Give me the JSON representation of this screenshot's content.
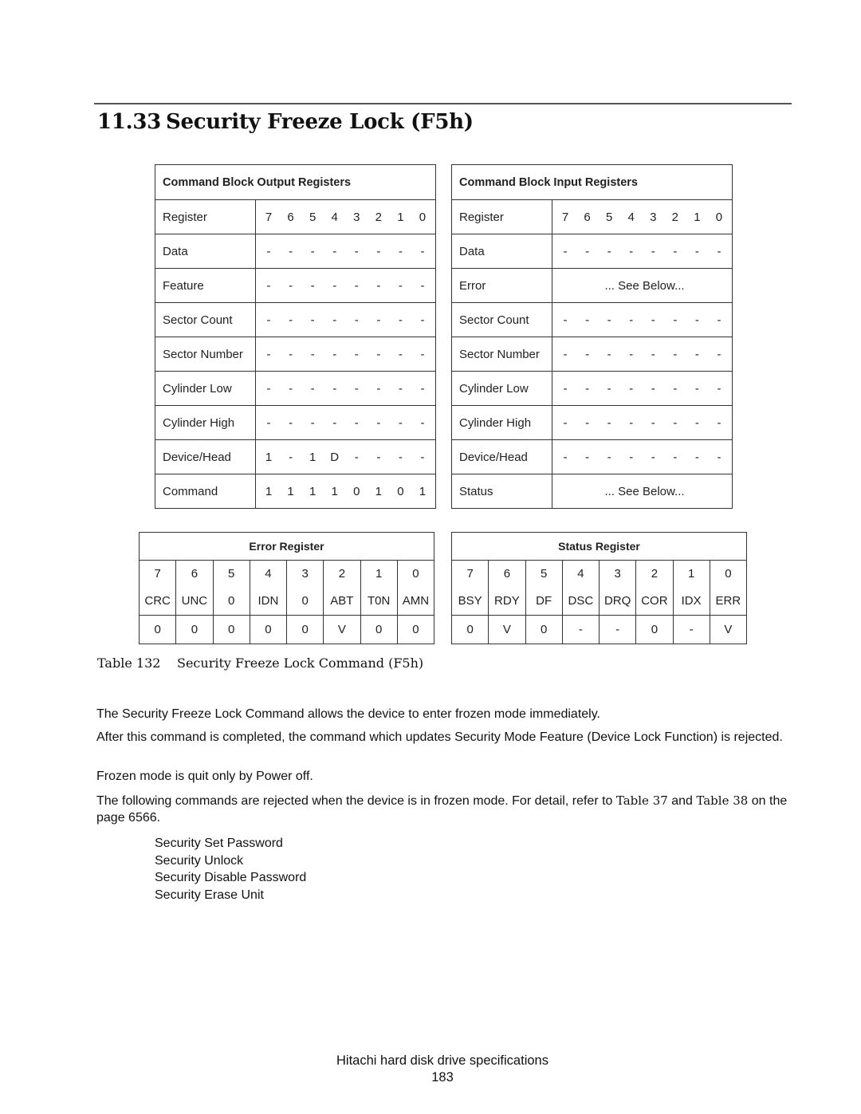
{
  "section": {
    "number": "11.33",
    "title": "Security Freeze Lock (F5h)"
  },
  "output_registers": {
    "header": "Command Block Output Registers",
    "rows": [
      {
        "name": "Register",
        "bits": [
          "7",
          "6",
          "5",
          "4",
          "3",
          "2",
          "1",
          "0"
        ]
      },
      {
        "name": "Data",
        "bits": [
          "-",
          "-",
          "-",
          "-",
          "-",
          "-",
          "-",
          "-"
        ]
      },
      {
        "name": "Feature",
        "bits": [
          "-",
          "-",
          "-",
          "-",
          "-",
          "-",
          "-",
          "-"
        ]
      },
      {
        "name": "Sector Count",
        "bits": [
          "-",
          "-",
          "-",
          "-",
          "-",
          "-",
          "-",
          "-"
        ]
      },
      {
        "name": "Sector Number",
        "bits": [
          "-",
          "-",
          "-",
          "-",
          "-",
          "-",
          "-",
          "-"
        ]
      },
      {
        "name": "Cylinder Low",
        "bits": [
          "-",
          "-",
          "-",
          "-",
          "-",
          "-",
          "-",
          "-"
        ]
      },
      {
        "name": "Cylinder High",
        "bits": [
          "-",
          "-",
          "-",
          "-",
          "-",
          "-",
          "-",
          "-"
        ]
      },
      {
        "name": "Device/Head",
        "bits": [
          "1",
          "-",
          "1",
          "D",
          "-",
          "-",
          "-",
          "-"
        ]
      },
      {
        "name": "Command",
        "bits": [
          "1",
          "1",
          "1",
          "1",
          "0",
          "1",
          "0",
          "1"
        ]
      }
    ]
  },
  "input_registers": {
    "header": "Command Block Input Registers",
    "rows": [
      {
        "name": "Register",
        "bits": [
          "7",
          "6",
          "5",
          "4",
          "3",
          "2",
          "1",
          "0"
        ]
      },
      {
        "name": "Data",
        "bits": [
          "-",
          "-",
          "-",
          "-",
          "-",
          "-",
          "-",
          "-"
        ]
      },
      {
        "name": "Error",
        "text": "... See Below..."
      },
      {
        "name": "Sector Count",
        "bits": [
          "-",
          "-",
          "-",
          "-",
          "-",
          "-",
          "-",
          "-"
        ]
      },
      {
        "name": "Sector Number",
        "bits": [
          "-",
          "-",
          "-",
          "-",
          "-",
          "-",
          "-",
          "-"
        ]
      },
      {
        "name": "Cylinder Low",
        "bits": [
          "-",
          "-",
          "-",
          "-",
          "-",
          "-",
          "-",
          "-"
        ]
      },
      {
        "name": "Cylinder High",
        "bits": [
          "-",
          "-",
          "-",
          "-",
          "-",
          "-",
          "-",
          "-"
        ]
      },
      {
        "name": "Device/Head",
        "bits": [
          "-",
          "-",
          "-",
          "-",
          "-",
          "-",
          "-",
          "-"
        ]
      },
      {
        "name": "Status",
        "text": "... See Below..."
      }
    ]
  },
  "error_register": {
    "header": "Error Register",
    "bit_numbers": [
      "7",
      "6",
      "5",
      "4",
      "3",
      "2",
      "1",
      "0"
    ],
    "bit_names": [
      "CRC",
      "UNC",
      "0",
      "IDN",
      "0",
      "ABT",
      "T0N",
      "AMN"
    ],
    "values": [
      "0",
      "0",
      "0",
      "0",
      "0",
      "V",
      "0",
      "0"
    ]
  },
  "status_register": {
    "header": "Status Register",
    "bit_numbers": [
      "7",
      "6",
      "5",
      "4",
      "3",
      "2",
      "1",
      "0"
    ],
    "bit_names": [
      "BSY",
      "RDY",
      "DF",
      "DSC",
      "DRQ",
      "COR",
      "IDX",
      "ERR"
    ],
    "values": [
      "0",
      "V",
      "0",
      "-",
      "-",
      "0",
      "-",
      "V"
    ]
  },
  "caption": {
    "label": "Table 132",
    "text": "Security Freeze Lock Command (F5h)"
  },
  "body": {
    "p1": "The Security Freeze Lock Command allows the device to enter frozen mode immediately.",
    "p2": "After this command is completed, the command which updates Security Mode Feature (Device Lock Function) is rejected.",
    "p3": "Frozen mode is quit only by Power off.",
    "p4_a": "The following commands are rejected when the device is in frozen mode. For detail, refer to ",
    "p4_ref1": "Table 37",
    "p4_b": " and ",
    "p4_ref2": "Table 38",
    "p4_c": " on the page 6566.",
    "commands": [
      "Security Set Password",
      "Security Unlock",
      "Security Disable Password",
      "Security Erase Unit"
    ]
  },
  "footer": {
    "title": "Hitachi hard disk drive specifications",
    "page": "183"
  }
}
